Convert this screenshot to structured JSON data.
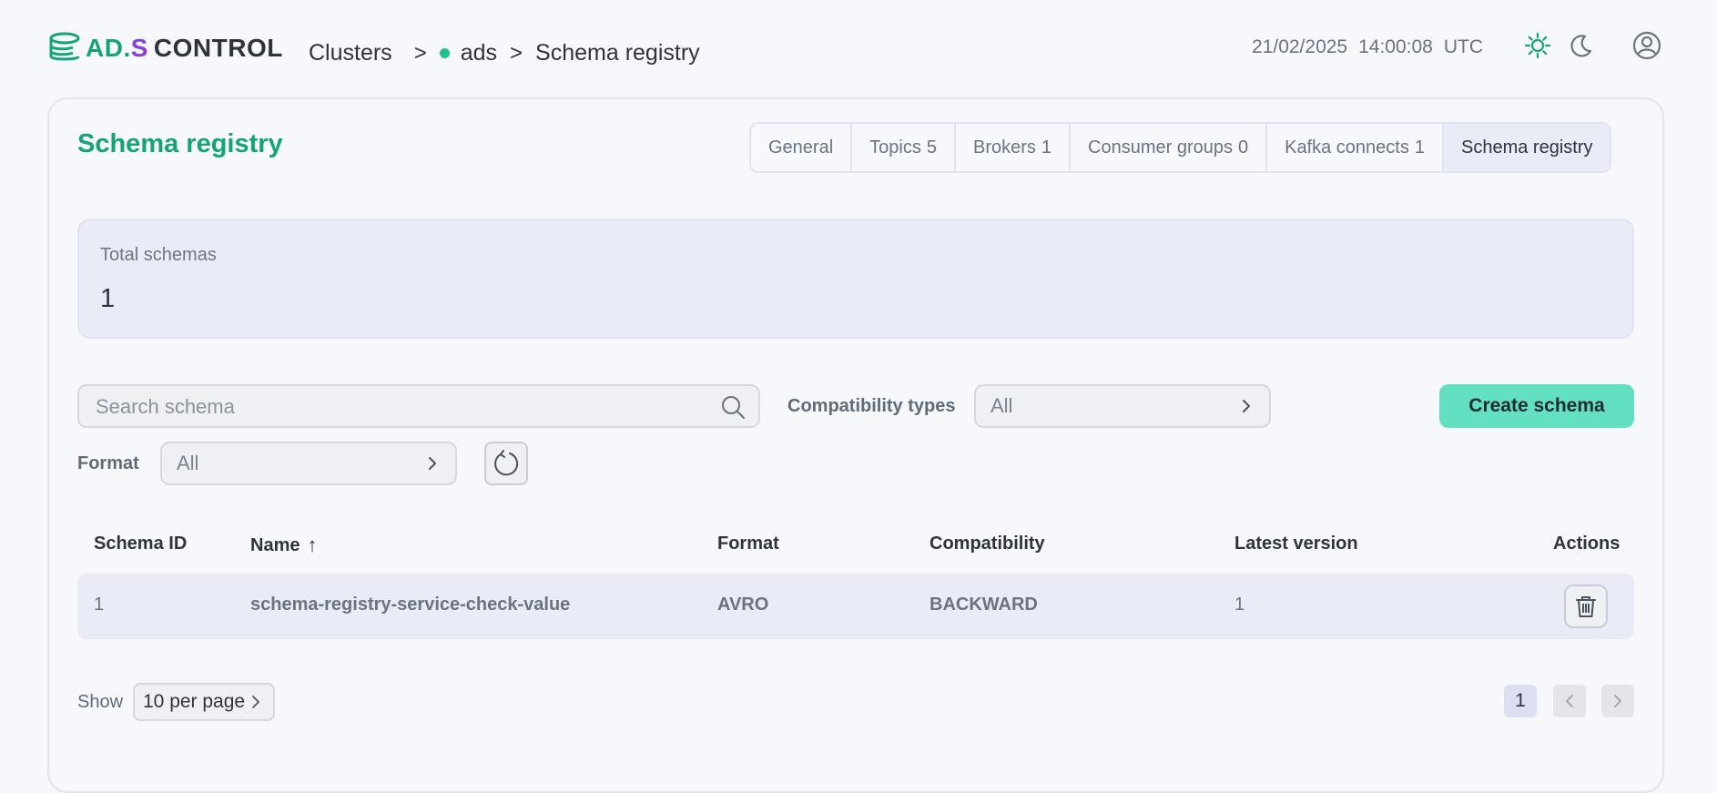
{
  "header": {
    "logo": {
      "ad": "AD.",
      "s": "S",
      "control": "CONTROL"
    },
    "breadcrumb": {
      "clusters": "Clusters",
      "sep": ">",
      "cluster": "ads",
      "page": "Schema registry"
    },
    "clock": {
      "date": "21/02/2025",
      "time": "14:00:08",
      "tz": "UTC"
    },
    "icons": [
      "sun-icon",
      "moon-icon",
      "user-icon"
    ],
    "accent": "#16a37a",
    "status_color": "#1fbf8f"
  },
  "page": {
    "title": "Schema registry",
    "tabs": [
      {
        "label": "General",
        "count": ""
      },
      {
        "label": "Topics",
        "count": "5"
      },
      {
        "label": "Brokers",
        "count": "1"
      },
      {
        "label": "Consumer groups",
        "count": "0"
      },
      {
        "label": "Kafka connects",
        "count": "1"
      },
      {
        "label": "Schema registry",
        "count": ""
      }
    ],
    "active_tab": "Schema registry"
  },
  "stats": {
    "label": "Total schemas",
    "value": "1"
  },
  "filters": {
    "search_placeholder": "Search schema",
    "compat_label": "Compatibility types",
    "compat_value": "All",
    "format_label": "Format",
    "format_value": "All",
    "create_label": "Create schema",
    "create_color": "#62e0c1"
  },
  "table": {
    "headers": {
      "id": "Schema ID",
      "name": "Name",
      "sort_arrow": "↑",
      "format": "Format",
      "compat": "Compatibility",
      "latest": "Latest version",
      "actions": "Actions"
    },
    "rows": [
      {
        "id": "1",
        "name": "schema-registry-service-check-value",
        "format": "AVRO",
        "compat": "BACKWARD",
        "latest": "1"
      }
    ]
  },
  "pagination": {
    "show_label": "Show",
    "per_page": "10 per page",
    "current_page": "1"
  }
}
